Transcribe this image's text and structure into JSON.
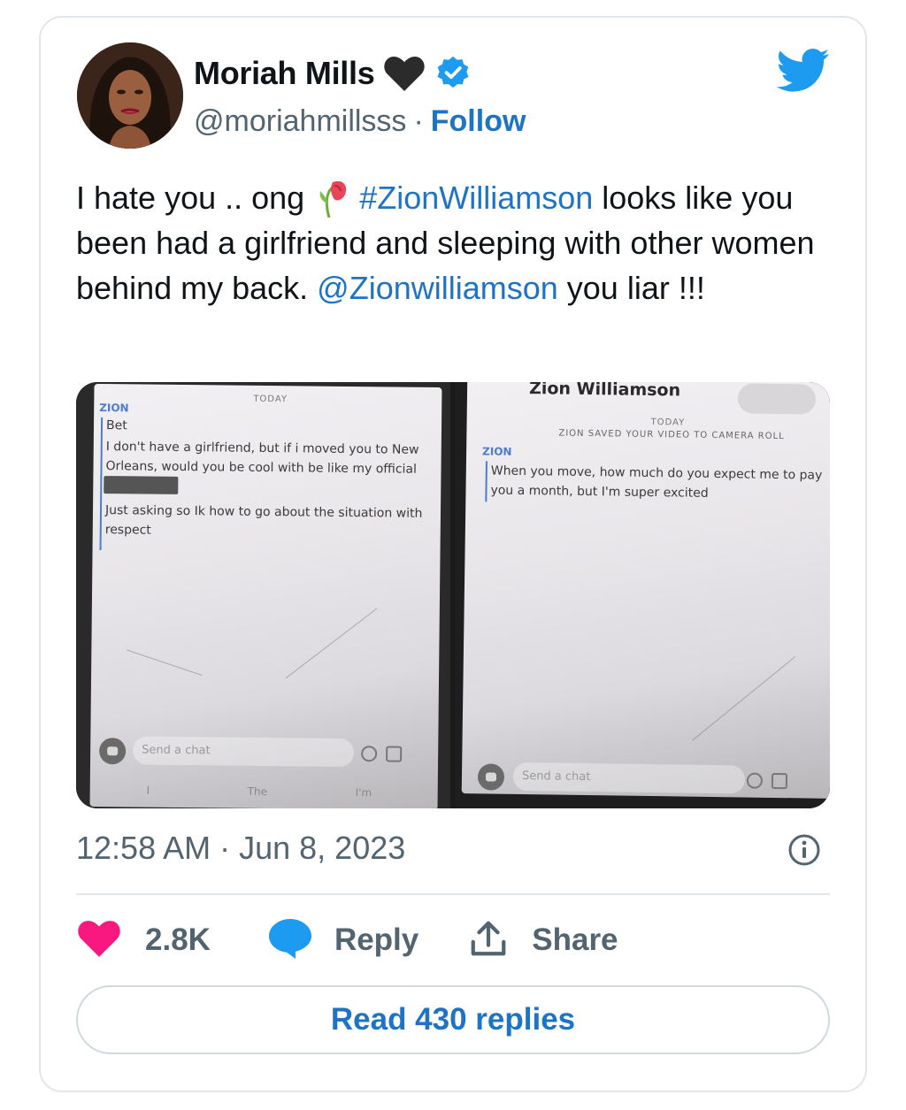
{
  "author": {
    "name": "Moriah Mills",
    "handle": "@moriahmillsss",
    "separator": "·",
    "follow_label": "Follow"
  },
  "tweet": {
    "text_part1": "I hate you .. ong",
    "hashtag": "#ZionWilliamson",
    "text_part2": " looks like you been had a girlfriend and sleeping with other women behind my back. ",
    "mention": "@Zionwilliamson",
    "text_part3": " you liar !!!"
  },
  "media": {
    "left": {
      "today": "TODAY",
      "sender": "ZION",
      "msg1": "Bet",
      "msg2": "I don't have a girlfriend, but if i moved you to New Orleans, would you be cool with be like my official",
      "msg3": "Just asking so Ik how to go about the situation with respect",
      "input_placeholder": "Send a chat",
      "kb_words": [
        "I",
        "The",
        "I'm"
      ]
    },
    "right": {
      "contact_name": "Zion Williamson",
      "today": "TODAY",
      "saved_note": "ZION SAVED YOUR VIDEO TO CAMERA ROLL",
      "sender": "ZION",
      "msg1": "When you move, how much do you expect me to pay you a month, but I'm super excited",
      "input_placeholder": "Send a chat"
    }
  },
  "timestamp": "12:58 AM · Jun 8, 2023",
  "actions": {
    "like_count": "2.8K",
    "reply_label": "Reply",
    "share_label": "Share"
  },
  "read_replies_label": "Read 430 replies",
  "colors": {
    "link_blue": "#1d73c6",
    "twitter_blue": "#1d9bf0",
    "like_pink": "#f91880",
    "muted": "#536471"
  }
}
